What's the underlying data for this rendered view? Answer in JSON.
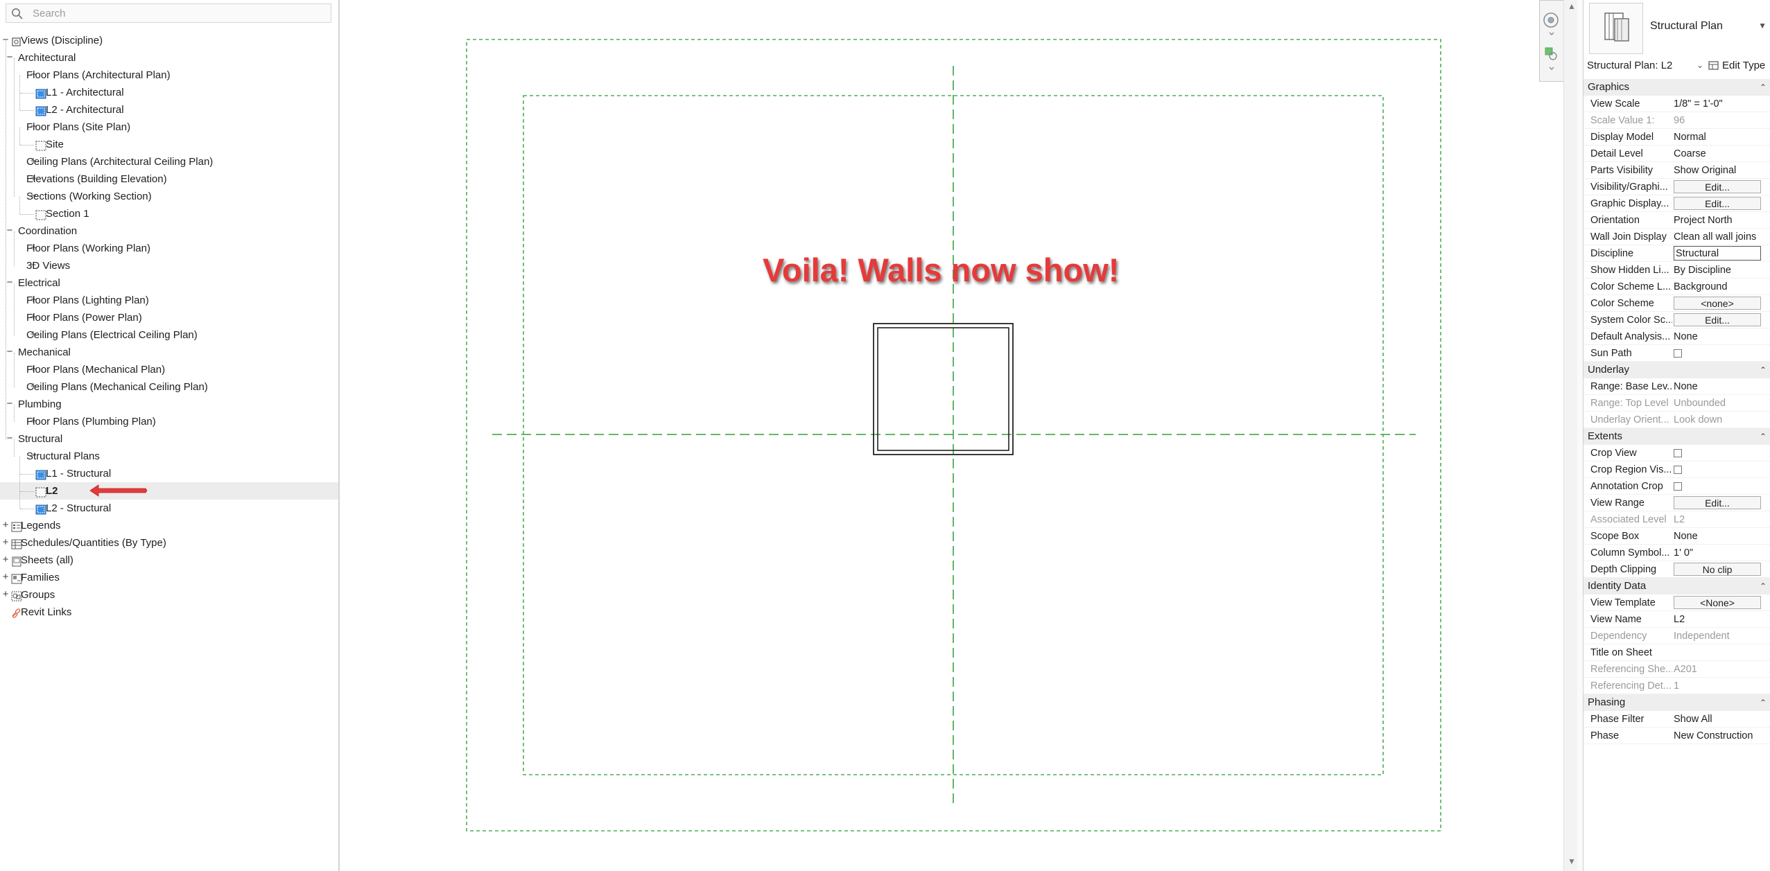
{
  "search": {
    "placeholder": "Search"
  },
  "tree": [
    {
      "label": "Views (Discipline)",
      "level": 0,
      "exp": "-",
      "icon": "views-icon",
      "name": "views-discipline"
    },
    {
      "label": "Architectural",
      "level": 1,
      "exp": "-",
      "name": "architectural"
    },
    {
      "label": "Floor Plans (Architectural Plan)",
      "level": 2,
      "exp": "-",
      "name": "floor-plans-architectural"
    },
    {
      "label": "L1 - Architectural",
      "level": 3,
      "icon": "floor-plan-view-icon",
      "name": "l1-architectural"
    },
    {
      "label": "L2 - Architectural",
      "level": 3,
      "icon": "floor-plan-view-icon",
      "name": "l2-architectural"
    },
    {
      "label": "Floor Plans (Site Plan)",
      "level": 2,
      "exp": "-",
      "name": "floor-plans-site"
    },
    {
      "label": "Site",
      "level": 3,
      "icon": "empty-view-icon",
      "name": "site"
    },
    {
      "label": "Ceiling Plans (Architectural Ceiling Plan)",
      "level": 2,
      "exp": "+",
      "name": "ceiling-plans-architectural"
    },
    {
      "label": "Elevations (Building Elevation)",
      "level": 2,
      "exp": "+",
      "name": "elevations-building"
    },
    {
      "label": "Sections (Working Section)",
      "level": 2,
      "exp": "-",
      "name": "sections-working"
    },
    {
      "label": "Section 1",
      "level": 3,
      "icon": "empty-view-icon",
      "name": "section-1"
    },
    {
      "label": "Coordination",
      "level": 1,
      "exp": "-",
      "name": "coordination"
    },
    {
      "label": "Floor Plans (Working Plan)",
      "level": 2,
      "exp": "+",
      "name": "floor-plans-working"
    },
    {
      "label": "3D Views",
      "level": 2,
      "exp": "+",
      "name": "3d-views"
    },
    {
      "label": "Electrical",
      "level": 1,
      "exp": "-",
      "name": "electrical"
    },
    {
      "label": "Floor Plans (Lighting Plan)",
      "level": 2,
      "exp": "+",
      "name": "floor-plans-lighting"
    },
    {
      "label": "Floor Plans (Power Plan)",
      "level": 2,
      "exp": "+",
      "name": "floor-plans-power"
    },
    {
      "label": "Ceiling Plans (Electrical Ceiling Plan)",
      "level": 2,
      "exp": "+",
      "name": "ceiling-plans-electrical"
    },
    {
      "label": "Mechanical",
      "level": 1,
      "exp": "-",
      "name": "mechanical"
    },
    {
      "label": "Floor Plans (Mechanical Plan)",
      "level": 2,
      "exp": "+",
      "name": "floor-plans-mechanical"
    },
    {
      "label": "Ceiling Plans (Mechanical Ceiling Plan)",
      "level": 2,
      "exp": "+",
      "name": "ceiling-plans-mechanical"
    },
    {
      "label": "Plumbing",
      "level": 1,
      "exp": "-",
      "name": "plumbing"
    },
    {
      "label": "Floor Plans (Plumbing Plan)",
      "level": 2,
      "exp": "+",
      "name": "floor-plans-plumbing"
    },
    {
      "label": "Structural",
      "level": 1,
      "exp": "-",
      "name": "structural"
    },
    {
      "label": "Structural Plans",
      "level": 2,
      "exp": "-",
      "name": "structural-plans"
    },
    {
      "label": "L1 - Structural",
      "level": 3,
      "icon": "floor-plan-view-icon",
      "name": "l1-structural"
    },
    {
      "label": "L2",
      "level": 3,
      "icon": "empty-view-icon",
      "selected": true,
      "name": "l2"
    },
    {
      "label": "L2 - Structural",
      "level": 3,
      "icon": "floor-plan-view-icon",
      "name": "l2-structural"
    },
    {
      "label": "Legends",
      "level": 0,
      "exp": "+",
      "icon": "legend-icon",
      "name": "legends"
    },
    {
      "label": "Schedules/Quantities (By Type)",
      "level": 0,
      "exp": "+",
      "icon": "schedule-icon",
      "name": "schedules"
    },
    {
      "label": "Sheets (all)",
      "level": 0,
      "exp": "+",
      "icon": "sheet-icon",
      "name": "sheets"
    },
    {
      "label": "Families",
      "level": 0,
      "exp": "+",
      "icon": "family-icon",
      "name": "families"
    },
    {
      "label": "Groups",
      "level": 0,
      "exp": "+",
      "icon": "group-icon",
      "name": "groups"
    },
    {
      "label": "Revit Links",
      "level": 0,
      "icon": "link-icon",
      "name": "revit-links"
    }
  ],
  "canvas": {
    "annotation": "Voila! Walls now show!",
    "arrow_color": "#e53a3a",
    "grid_color": "#4caf50"
  },
  "properties": {
    "type_name": "Structural Plan",
    "instance": "Structural Plan: L2",
    "edit_type": "Edit Type",
    "rows": [
      {
        "group": "Graphics",
        "name": "graphics"
      },
      {
        "name": "View Scale",
        "value": "1/8\" = 1'-0\""
      },
      {
        "name": "Scale Value    1:",
        "value": "96",
        "ro": true
      },
      {
        "name": "Display Model",
        "value": "Normal"
      },
      {
        "name": "Detail Level",
        "value": "Coarse"
      },
      {
        "name": "Parts Visibility",
        "value": "Show Original"
      },
      {
        "name": "Visibility/Graphi...",
        "value": "Edit...",
        "button": true
      },
      {
        "name": "Graphic Display...",
        "value": "Edit...",
        "button": true
      },
      {
        "name": "Orientation",
        "value": "Project North"
      },
      {
        "name": "Wall Join Display",
        "value": "Clean all wall joins"
      },
      {
        "name": "Discipline",
        "value": "Structural",
        "field": true
      },
      {
        "name": "Show Hidden Li...",
        "value": "By Discipline"
      },
      {
        "name": "Color Scheme L...",
        "value": "Background"
      },
      {
        "name": "Color Scheme",
        "value": "<none>",
        "button": true
      },
      {
        "name": "System Color Sc...",
        "value": "Edit...",
        "button": true
      },
      {
        "name": "Default Analysis...",
        "value": "None"
      },
      {
        "name": "Sun Path",
        "checkbox": true
      },
      {
        "group": "Underlay",
        "name": "underlay"
      },
      {
        "name": "Range: Base Lev...",
        "value": "None"
      },
      {
        "name": "Range: Top Level",
        "value": "Unbounded",
        "ro": true
      },
      {
        "name": "Underlay Orient...",
        "value": "Look down",
        "ro": true
      },
      {
        "group": "Extents",
        "name": "extents"
      },
      {
        "name": "Crop View",
        "checkbox": true
      },
      {
        "name": "Crop Region Vis...",
        "checkbox": true
      },
      {
        "name": "Annotation Crop",
        "checkbox": true
      },
      {
        "name": "View Range",
        "value": "Edit...",
        "button": true
      },
      {
        "name": "Associated Level",
        "value": "L2",
        "ro": true
      },
      {
        "name": "Scope Box",
        "value": "None"
      },
      {
        "name": "Column Symbol...",
        "value": "1'  0\""
      },
      {
        "name": "Depth Clipping",
        "value": "No clip",
        "button": true
      },
      {
        "group": "Identity Data",
        "name": "identity-data"
      },
      {
        "name": "View Template",
        "value": "<None>",
        "button": true
      },
      {
        "name": "View Name",
        "value": "L2"
      },
      {
        "name": "Dependency",
        "value": "Independent",
        "ro": true
      },
      {
        "name": "Title on Sheet",
        "value": ""
      },
      {
        "name": "Referencing She...",
        "value": "A201",
        "ro": true
      },
      {
        "name": "Referencing Det...",
        "value": "1",
        "ro": true
      },
      {
        "group": "Phasing",
        "name": "phasing"
      },
      {
        "name": "Phase Filter",
        "value": "Show All"
      },
      {
        "name": "Phase",
        "value": "New Construction"
      }
    ]
  }
}
